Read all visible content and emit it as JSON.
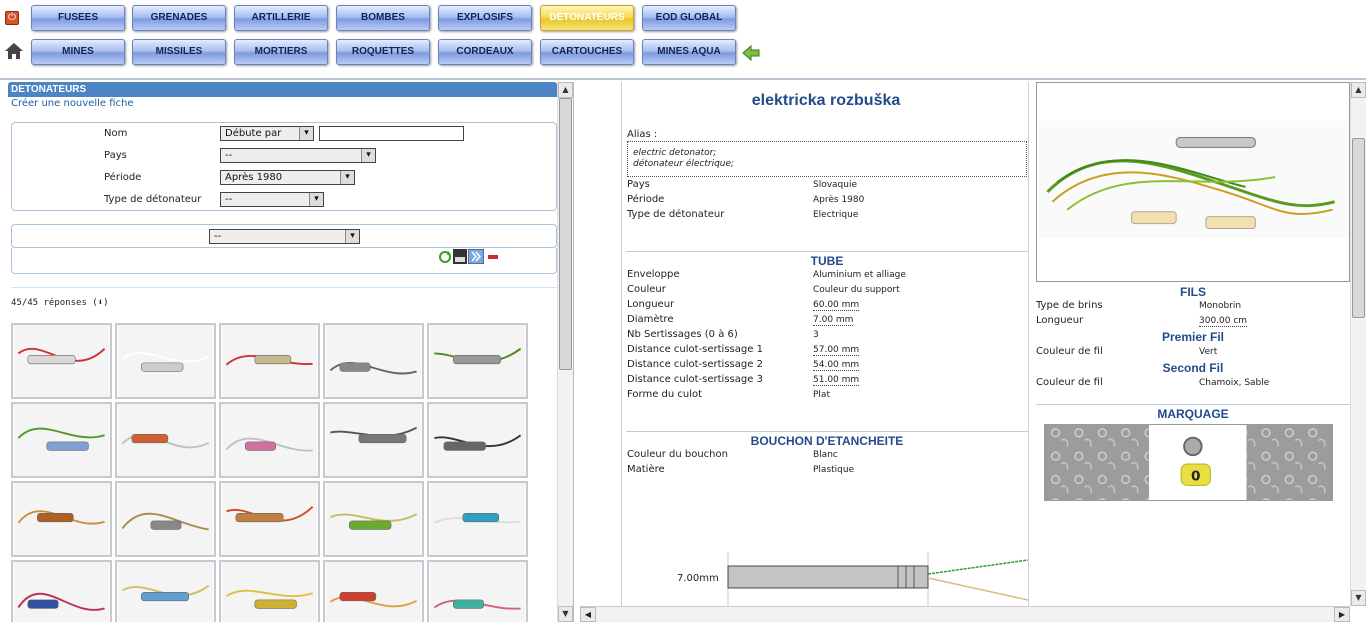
{
  "nav": {
    "row1": [
      "FUSEES",
      "GRENADES",
      "ARTILLERIE",
      "BOMBES",
      "EXPLOSIFS",
      "DETONATEURS",
      "EOD GLOBAL"
    ],
    "row2": [
      "MINES",
      "MISSILES",
      "MORTIERS",
      "ROQUETTES",
      "CORDEAUX",
      "CARTOUCHES",
      "MINES AQUA"
    ],
    "active": "DETONATEURS"
  },
  "search": {
    "header": "DETONATEURS",
    "new_link": "Créer une nouvelle fiche",
    "name_label": "Nom",
    "name_mode": "Débute par",
    "country_label": "Pays",
    "country_value": "--",
    "period_label": "Période",
    "period_value": "Après 1980",
    "type_label": "Type de détonateur",
    "type_value": "--",
    "extra_value": "--",
    "results_count": "45/45 réponses (⬇)"
  },
  "fiche": {
    "title": "elektricka rozbuška",
    "alias_label": "Alias :",
    "aliases": [
      "electric detonator;",
      "détonateur électrique;"
    ],
    "general": [
      {
        "label": "Pays",
        "value": "Slovaquie"
      },
      {
        "label": "Période",
        "value": "Après 1980"
      },
      {
        "label": "Type de détonateur",
        "value": "Electrique"
      }
    ],
    "tube_title": "TUBE",
    "tube": [
      {
        "label": "Enveloppe",
        "value": "Aluminium et alliage"
      },
      {
        "label": "Couleur",
        "value": "Couleur du support"
      },
      {
        "label": "Longueur",
        "value": "60.00 mm"
      },
      {
        "label": "Diamètre",
        "value": "7.00 mm"
      },
      {
        "label": "Nb Sertissages (0 à 6)",
        "value": "3"
      },
      {
        "label": "Distance culot-sertissage 1",
        "value": "57.00 mm"
      },
      {
        "label": "Distance culot-sertissage 2",
        "value": "54.00 mm"
      },
      {
        "label": "Distance culot-sertissage 3",
        "value": "51.00 mm"
      },
      {
        "label": "Forme du culot",
        "value": "Plat"
      }
    ],
    "bouchon_title": "BOUCHON D'ETANCHEITE",
    "bouchon": [
      {
        "label": "Couleur du bouchon",
        "value": "Blanc"
      },
      {
        "label": "Matière",
        "value": "Plastique"
      }
    ],
    "diagram_label": "7.00mm",
    "fils_title": "FILS",
    "fils": [
      {
        "label": "Type de brins",
        "value": "Monobrin"
      },
      {
        "label": "Longueur",
        "value": "300.00 cm"
      }
    ],
    "premier_title": "Premier Fil",
    "premier": [
      {
        "label": "Couleur de fil",
        "value": "Vert"
      }
    ],
    "second_title": "Second Fil",
    "second": [
      {
        "label": "Couleur de fil",
        "value": "Chamoix, Sable"
      }
    ],
    "marquage_title": "MARQUAGE",
    "marquage_text": "0"
  },
  "colors": {
    "accent": "#4d84c4",
    "title": "#244a8c",
    "active_tab": "#f0d040"
  }
}
